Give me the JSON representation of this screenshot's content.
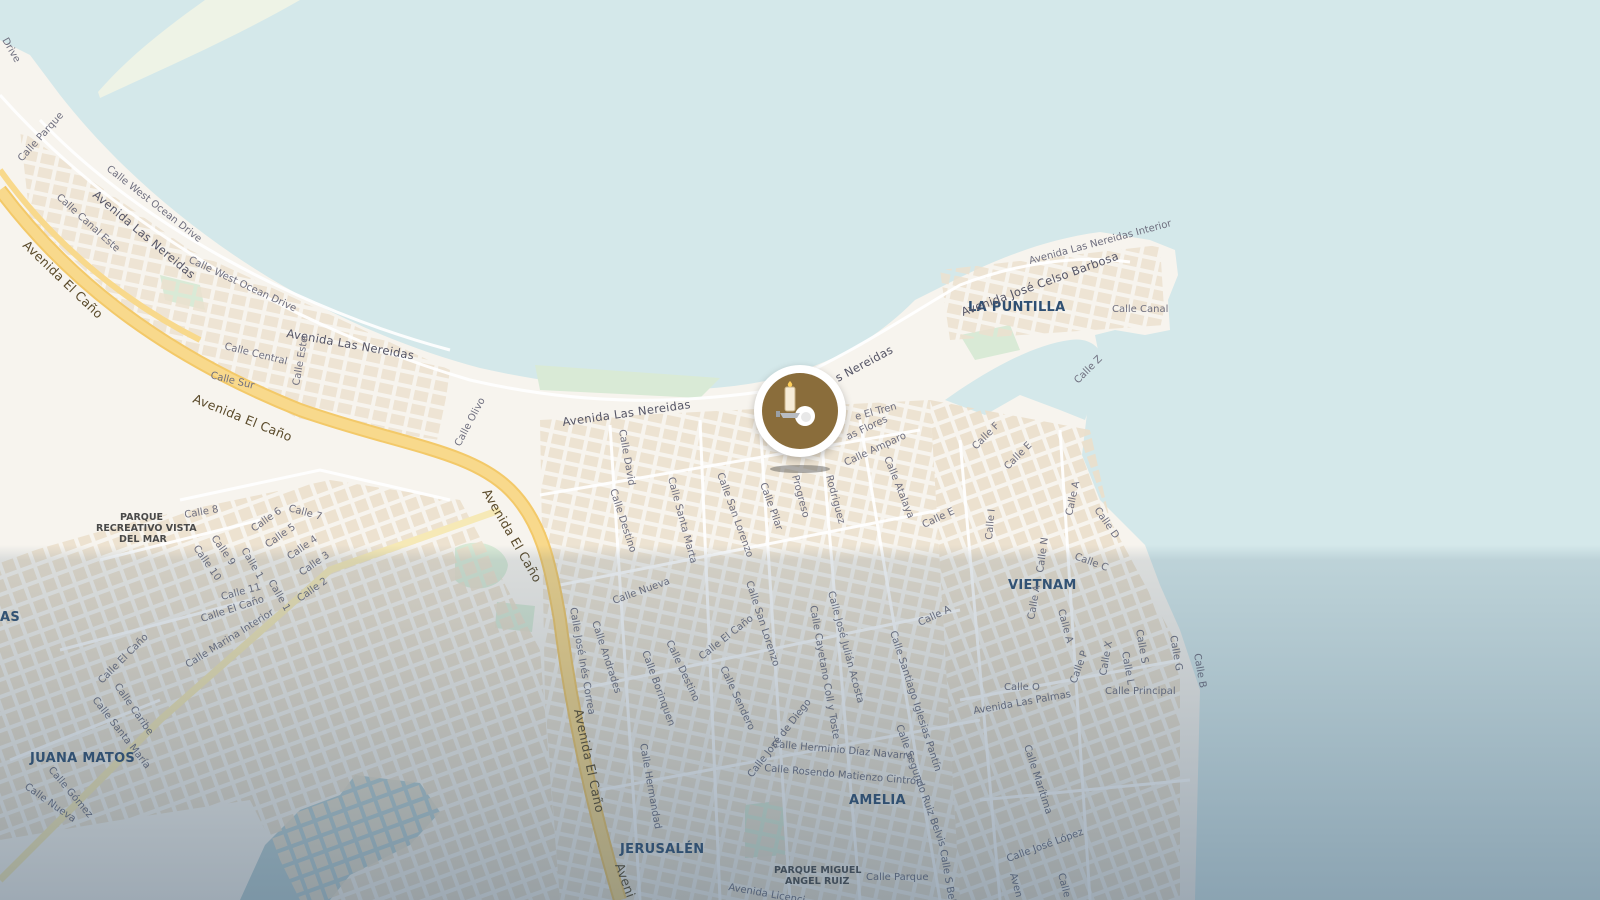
{
  "map": {
    "water_color": "#d4e8ea",
    "land_color": "#f7f4ee",
    "block_color": "#eee3d2",
    "highway_color": "#f8d47f",
    "park_color": "#d9ead6",
    "neighborhoods": {
      "la_puntilla": "LA PUNTILLA",
      "vietnam": "VIETNAM",
      "juana_matos": "JUANA MATOS",
      "amelia": "AMELIA",
      "jerusalen": "JERUSALÉN",
      "edge_fragment": "AS"
    },
    "parks": {
      "vista_del_mar_1": "PARQUE",
      "vista_del_mar_2": "RECREATIVO VISTA",
      "vista_del_mar_3": "DEL MAR",
      "miguel_angel_1": "PARQUE MIGUEL",
      "miguel_angel_2": "ANGEL RUIZ"
    },
    "highways": {
      "el_cano_1": "Avenida El Caño",
      "el_cano_2": "Avenida El Caño",
      "el_cano_3": "Avenida El Caño",
      "el_cano_4": "Avenida El Caño",
      "el_cano_5": "Aveni"
    },
    "streets": {
      "drive": "Drive",
      "calle_parque_nw": "Calle Parque",
      "west_ocean_1": "Calle West Ocean Drive",
      "canal_este": "Calle Canal Este",
      "nereidas_1": "Avenida Las Nereidas",
      "west_ocean_2": "Calle West Ocean Drive",
      "nereidas_2": "Avenida Las Nereidas",
      "central": "Calle Central",
      "calle_este": "Calle Este",
      "calle_sur": "Calle Sur",
      "olivo": "Calle Olivo",
      "nereidas_3": "Avenida Las Nereidas",
      "nereidas_4": "s Nereidas",
      "nereidas_interior": "Avenida Las Nereidas Interior",
      "celso_barbosa": "Avenida José Celso Barbosa",
      "calle_canal": "Calle Canal",
      "calle_z": "Calle Z",
      "el_tren": "e El Tren",
      "flores": "as Flores",
      "amparo": "Calle Amparo",
      "atalaya": "Calle Atalaya",
      "calle_f": "Calle F",
      "calle_e1": "Calle E",
      "calle_e2": "Calle E",
      "calle_a1": "Calle A",
      "calle_d": "Calle D",
      "calle_i": "Calle I",
      "calle_c1": "Calle C",
      "calle_n": "Calle N",
      "calle_a2": "Calle A",
      "calle_a3": "Calle A",
      "david": "Calle David",
      "destino_1": "Calle Destino",
      "santa_marta": "Calle Santa Marta",
      "san_lorenzo_1": "Calle San Lorenzo",
      "pilar": "Calle Pilar",
      "progreso": "Progreso",
      "rodriguez": "Rodriguez",
      "calle_8": "Calle 8",
      "calle_7": "Calle 7",
      "calle_6": "Calle 6",
      "calle_5": "Calle 5",
      "calle_9": "Calle 9",
      "calle_4": "Calle 4",
      "calle_10": "Calle 10",
      "calle_1a": "Calle 1",
      "calle_3": "Calle 3",
      "calle_11": "Calle 11",
      "calle_1b": "Calle 1",
      "calle_2": "Calle 2",
      "el_cano_calle_1": "Calle El Caño",
      "marina_interior": "Calle Marina Interior",
      "el_cano_calle_2": "Calle El Caño",
      "caribe": "Calle Caribe",
      "santa_maria": "Calle Santa María",
      "gomez": "Calle Gómez",
      "nueva_sw": "Calle Nueva",
      "nueva": "Calle Nueva",
      "jose_ines_correa": "Calle José Inés Correa",
      "andrades": "Calle Andrades",
      "borinquen": "Calle Borinquen",
      "destino_2": "Calle Destino",
      "el_cano_calle_3": "Calle El Caño",
      "san_lorenzo_2": "Calle San Lorenzo",
      "sendero": "Calle Sendero",
      "jose_de_diego": "Calle José de Diego",
      "jose_julian_acosta": "Calle José Julián Acosta",
      "cayetano_coll": "Calle Cayetano Coll y Toste",
      "santiago_iglesias": "Calle Santiago Iglesias Pantín",
      "hermenegildo": "Calle Hermandad",
      "herminio": "Calle Herminio Díaz Navarro",
      "rosendo": "Calle Rosendo Matienzo Cintrón",
      "segundo_ruiz": "Calle Segundo Ruiz Belvis",
      "calle_a4": "Calle A",
      "calle_o": "Calle O",
      "las_palmas": "Avenida Las Palmas",
      "calle_p": "Calle P",
      "calle_x": "Calle X",
      "calle_s": "Calle S",
      "calle_l": "Calle L",
      "calle_g": "Calle G",
      "calle_b": "Calle B",
      "principal": "Calle Principal",
      "maritima": "Calle Marítima",
      "jose_lopez": "Calle José López",
      "calle_parque_s": "Calle Parque",
      "licenciado": "Avenida Licenci",
      "aven_fragment": "Aven",
      "s_belvis": "Calle S Belvis",
      "calle_3_se": "Calle 3"
    }
  },
  "pin": {
    "label": "Location marker",
    "ring_color": "#ffffff",
    "fill_color": "#8a6d3b",
    "icon": "candle-icon"
  }
}
